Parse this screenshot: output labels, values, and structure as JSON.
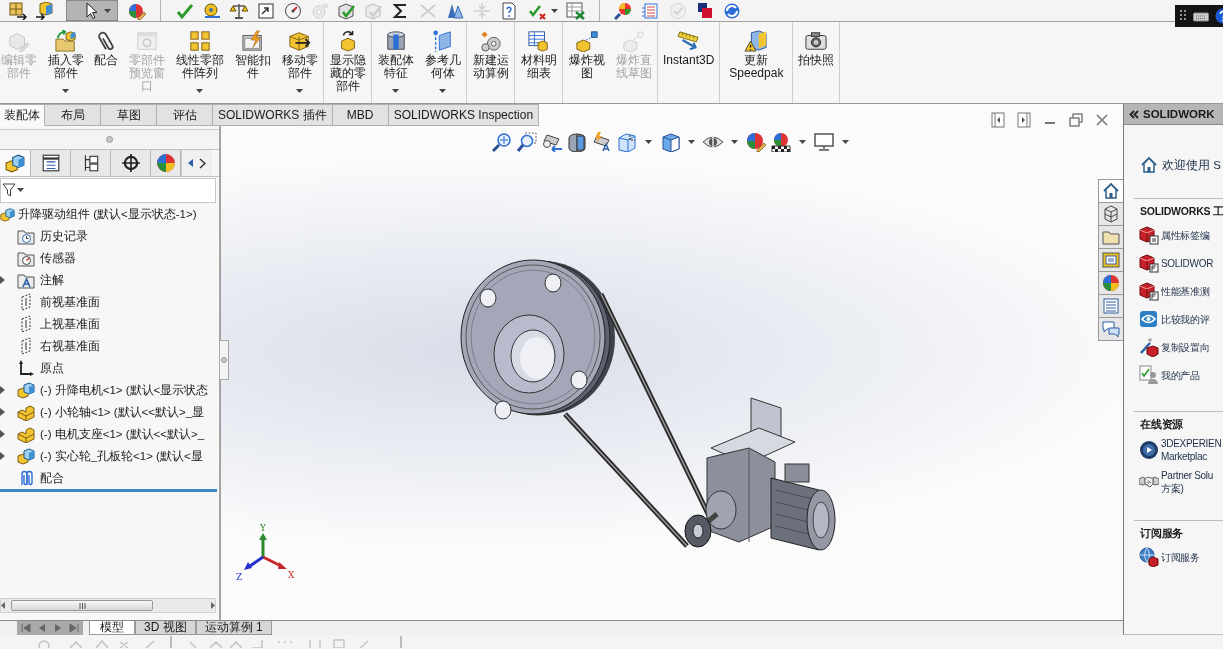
{
  "quick_toolbar": [
    [
      {
        "disabled": false,
        "selected": false,
        "dropdown": false
      },
      {
        "disabled": false,
        "selected": false,
        "dropdown": false
      },
      {
        "disabled": false,
        "selected": true,
        "dropdown": true
      },
      {
        "disabled": false,
        "selected": false,
        "dropdown": false
      }
    ],
    [
      {
        "disabled": false,
        "selected": false,
        "dropdown": false
      },
      {
        "disabled": false,
        "selected": false,
        "dropdown": false
      },
      {
        "disabled": false,
        "selected": false,
        "dropdown": false
      },
      {
        "disabled": false,
        "selected": false,
        "dropdown": false
      },
      {
        "disabled": false,
        "selected": false,
        "dropdown": false
      },
      {
        "disabled": true,
        "selected": false,
        "dropdown": false
      },
      {
        "disabled": false,
        "selected": false,
        "dropdown": false
      },
      {
        "disabled": true,
        "selected": false,
        "dropdown": false
      },
      {
        "disabled": false,
        "selected": false,
        "dropdown": false
      },
      {
        "disabled": true,
        "selected": false,
        "dropdown": false
      },
      {
        "disabled": false,
        "selected": false,
        "dropdown": false
      },
      {
        "disabled": true,
        "selected": false,
        "dropdown": false
      },
      {
        "disabled": false,
        "selected": false,
        "dropdown": false
      },
      {
        "disabled": false,
        "selected": false,
        "dropdown": true
      },
      {
        "disabled": false,
        "selected": false,
        "dropdown": false
      }
    ],
    [
      {
        "disabled": false,
        "selected": false,
        "dropdown": false
      },
      {
        "disabled": false,
        "selected": false,
        "dropdown": false
      },
      {
        "disabled": true,
        "selected": false,
        "dropdown": false
      },
      {
        "disabled": false,
        "selected": false,
        "dropdown": false
      },
      {
        "disabled": false,
        "selected": false,
        "dropdown": false
      }
    ]
  ],
  "ribbon": [
    [
      {
        "label": "编辑零部件",
        "disabled": true,
        "dropdown": false
      },
      {
        "label": "插入零部件",
        "disabled": false,
        "dropdown": true
      },
      {
        "label": "配合",
        "disabled": false,
        "dropdown": false
      },
      {
        "label": "零部件预览窗口",
        "disabled": true,
        "dropdown": false
      },
      {
        "label": "线性零部件阵列",
        "disabled": false,
        "dropdown": true
      },
      {
        "label": "智能扣件",
        "disabled": false,
        "dropdown": false
      },
      {
        "label": "移动零部件",
        "disabled": false,
        "dropdown": true
      }
    ],
    [
      {
        "label": "显示隐藏的零部件",
        "disabled": false,
        "dropdown": false
      }
    ],
    [
      {
        "label": "装配体特征",
        "disabled": false,
        "dropdown": true
      },
      {
        "label": "参考几何体",
        "disabled": false,
        "dropdown": true
      }
    ],
    [
      {
        "label": "新建运动算例",
        "disabled": false,
        "dropdown": false
      }
    ],
    [
      {
        "label": "材料明细表",
        "disabled": false,
        "dropdown": false
      }
    ],
    [
      {
        "label": "爆炸视图",
        "disabled": false,
        "dropdown": false
      },
      {
        "label": "爆炸直线草图",
        "disabled": true,
        "dropdown": false
      }
    ],
    [
      {
        "label": "Instant3D",
        "disabled": false,
        "dropdown": false
      }
    ],
    [
      {
        "label": "更新Speedpak",
        "disabled": false,
        "dropdown": false
      }
    ],
    [
      {
        "label": "拍快照",
        "disabled": false,
        "dropdown": false
      }
    ]
  ],
  "tabs": [
    {
      "label": "装配体",
      "selected": true
    },
    {
      "label": "布局",
      "selected": false
    },
    {
      "label": "草图",
      "selected": false
    },
    {
      "label": "评估",
      "selected": false
    },
    {
      "label": "SOLIDWORKS 插件",
      "selected": false
    },
    {
      "label": "MBD",
      "selected": false
    },
    {
      "label": "SOLIDWORKS Inspection",
      "selected": false
    }
  ],
  "feature_manager": {
    "tabs": [
      {
        "selected": true
      },
      {
        "selected": false
      },
      {
        "selected": false
      },
      {
        "selected": false
      },
      {
        "selected": false
      }
    ],
    "tree": {
      "label": "升降驱动组件 (默认<显示状态-1>)",
      "kind": "assembly",
      "children": [
        {
          "label": "历史记录",
          "kind": "history"
        },
        {
          "label": "传感器",
          "kind": "sensors"
        },
        {
          "label": "注解",
          "kind": "annotations",
          "expanded": false
        },
        {
          "label": "前视基准面",
          "kind": "plane"
        },
        {
          "label": "上视基准面",
          "kind": "plane"
        },
        {
          "label": "右视基准面",
          "kind": "plane"
        },
        {
          "label": "原点",
          "kind": "origin"
        },
        {
          "label": "(-) 升降电机<1> (默认<显示状态",
          "kind": "assembly",
          "expanded": false
        },
        {
          "label": "(-) 小轮轴<1> (默认<<默认>_显",
          "kind": "part",
          "expanded": false
        },
        {
          "label": "(-) 电机支座<1> (默认<<默认>_",
          "kind": "part",
          "expanded": false
        },
        {
          "label": "(-) 实心轮_孔板轮<1> (默认<显",
          "kind": "assembly",
          "expanded": false
        },
        {
          "label": "配合",
          "kind": "mates"
        }
      ]
    }
  },
  "viewport": {
    "triad": {
      "x": "X",
      "y": "Y",
      "z": "Z"
    }
  },
  "bottom_tabs": [
    {
      "label": "模型",
      "selected": true
    },
    {
      "label": "3D 视图",
      "selected": false
    },
    {
      "label": "运动算例 1",
      "selected": false
    }
  ],
  "task_pane": {
    "title": "SOLIDWORK",
    "tabs": [
      {
        "selected": true
      },
      {
        "selected": false
      },
      {
        "selected": false
      },
      {
        "selected": false
      },
      {
        "selected": false
      },
      {
        "selected": false
      },
      {
        "selected": false
      }
    ],
    "welcome": "欢迎使用 S",
    "sections": [
      {
        "title": "SOLIDWORKS 工",
        "items": [
          "属性标签编",
          "SOLIDWOR",
          "性能基准测",
          "比较我的评",
          "复制设置向",
          "我的产品"
        ]
      },
      {
        "title": "在线资源",
        "items": [
          "3DEXPERIEN\nMarketplac",
          "Partner Solu\n方案)"
        ]
      },
      {
        "title": "订阅服务",
        "items": [
          "订阅服务"
        ]
      }
    ]
  }
}
